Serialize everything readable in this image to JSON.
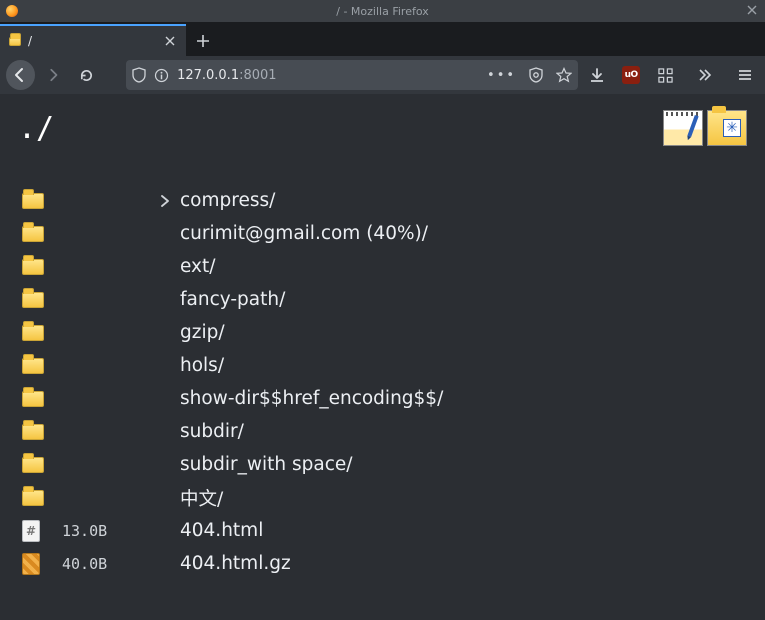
{
  "window": {
    "title": "/ - Mozilla Firefox"
  },
  "tab": {
    "label": "/"
  },
  "url": {
    "host": "127.0.0.1",
    "port": ":8001"
  },
  "page": {
    "title": "./",
    "entries": [
      {
        "type": "dir",
        "name": "compress/",
        "size": "",
        "expandable": true
      },
      {
        "type": "dir",
        "name": "curimit@gmail.com (40%)/",
        "size": "",
        "expandable": false
      },
      {
        "type": "dir",
        "name": "ext/",
        "size": "",
        "expandable": false
      },
      {
        "type": "dir",
        "name": "fancy-path/",
        "size": "",
        "expandable": false
      },
      {
        "type": "dir",
        "name": "gzip/",
        "size": "",
        "expandable": false
      },
      {
        "type": "dir",
        "name": "hols/",
        "size": "",
        "expandable": false
      },
      {
        "type": "dir",
        "name": "show-dir$$href_encoding$$/",
        "size": "",
        "expandable": false
      },
      {
        "type": "dir",
        "name": "subdir/",
        "size": "",
        "expandable": false
      },
      {
        "type": "dir",
        "name": "subdir_with space/",
        "size": "",
        "expandable": false
      },
      {
        "type": "dir",
        "name": "中文/",
        "size": "",
        "expandable": false
      },
      {
        "type": "html",
        "name": "404.html",
        "size": "13.0B",
        "expandable": false
      },
      {
        "type": "gz",
        "name": "404.html.gz",
        "size": "40.0B",
        "expandable": false
      }
    ]
  }
}
